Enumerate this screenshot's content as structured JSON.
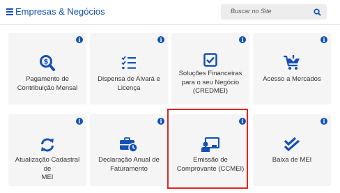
{
  "header": {
    "title": "Empresas & Negócios",
    "search_placeholder": "Buscar no Site"
  },
  "cards": [
    {
      "label_lines": [
        "Pagamento de",
        "Contribuição Mensal"
      ],
      "icon": "search-dollar-icon"
    },
    {
      "label_lines": [
        "Dispensa de Alvará e",
        "Licença"
      ],
      "icon": "checklist-icon"
    },
    {
      "label_lines": [
        "Soluções Financeiras",
        "para o seu Negócio",
        "(CREDMEI)"
      ],
      "icon": "checkbox-icon"
    },
    {
      "label_lines": [
        "Acesso a Mercados"
      ],
      "icon": "cart-download-icon"
    },
    {
      "label_lines": [
        "Atualização Cadastral de",
        "MEI"
      ],
      "icon": "sync-icon"
    },
    {
      "label_lines": [
        "Declaração Anual de",
        "Faturamento"
      ],
      "icon": "briefcase-clock-icon"
    },
    {
      "label_lines": [
        "Emissão de",
        "Comprovante (CCMEI)"
      ],
      "icon": "presentation-icon"
    },
    {
      "label_lines": [
        "Baixa de MEI"
      ],
      "icon": "double-check-icon"
    }
  ],
  "info_symbol": "i",
  "colors": {
    "accent": "#1351b4",
    "card_bg": "#f5f5f5",
    "highlight": "#e52222"
  }
}
